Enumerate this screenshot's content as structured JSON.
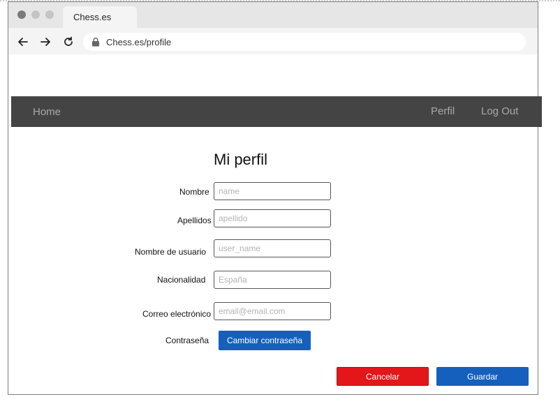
{
  "browser": {
    "tab_title": "Chess.es",
    "url": "Chess.es/profile"
  },
  "site_nav": {
    "home": "Home",
    "profile": "Perfil",
    "logout": "Log Out"
  },
  "form": {
    "title": "Mi perfil",
    "fields": [
      {
        "label": "Nombre",
        "placeholder": "name",
        "value": ""
      },
      {
        "label": "Apellidos",
        "placeholder": "apellido",
        "value": ""
      },
      {
        "label": "Nombre de usuario",
        "placeholder": "user_name",
        "value": ""
      },
      {
        "label": "Nacionalidad",
        "placeholder": "España",
        "value": ""
      },
      {
        "label": "Correo electrónico",
        "placeholder": "email@email.com",
        "value": ""
      }
    ],
    "password_label": "Contraseña",
    "change_password_button": "Cambiar contraseña",
    "cancel_button": "Cancelar",
    "save_button": "Guardar"
  },
  "colors": {
    "nav_background": "#444444",
    "primary_button": "#1560bd",
    "cancel_button": "#e3161a"
  },
  "icons": [
    "back-arrow-icon",
    "forward-arrow-icon",
    "reload-icon",
    "lock-icon"
  ]
}
